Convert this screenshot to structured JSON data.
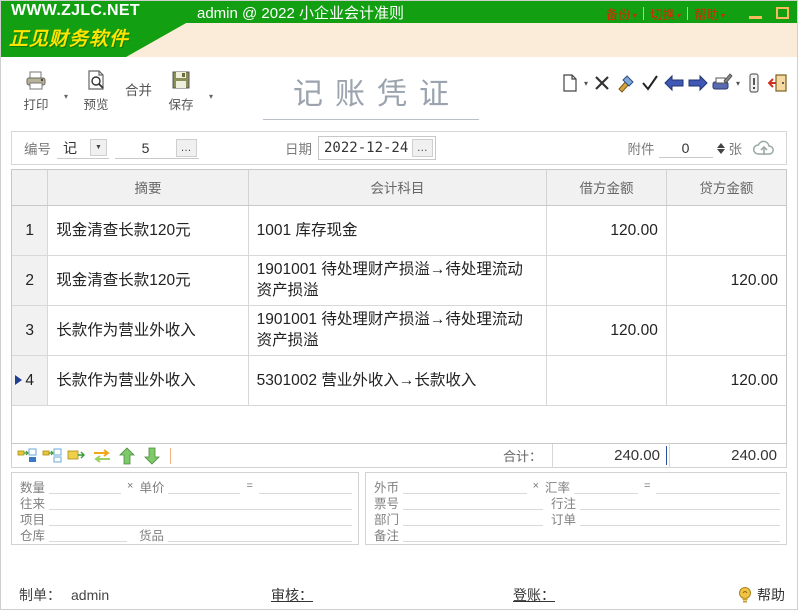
{
  "titlebar": {
    "logo_url": "WWW.ZJLC.NET",
    "logo_cn": "正见财务软件",
    "session": "admin @ 2022 小企业会计准则",
    "menus": [
      {
        "label": "备份",
        "caret": "▾"
      },
      {
        "label": "切换",
        "caret": "▾"
      },
      {
        "label": "帮助",
        "caret": "▾"
      }
    ],
    "window": {
      "minimize": "minimize-button",
      "maximize": "maximize-button"
    }
  },
  "toolbar": {
    "print_label": "打印",
    "preview_label": "预览",
    "merge_label": "合并",
    "save_label": "保存",
    "dropdown_caret": "▾",
    "right_icons": [
      "new-document-icon",
      "delete-x-icon",
      "tools-icon",
      "check-icon",
      "prev-arrow-icon",
      "next-arrow-icon",
      "print-icon",
      "info-icon",
      "exit-icon"
    ]
  },
  "document": {
    "title": "记账凭证"
  },
  "meta": {
    "number_label": "编号",
    "voucher_type": "记",
    "voucher_no": "5",
    "ellipsis": "…",
    "date_label": "日期",
    "date_value": "2022-12-24",
    "attach_label": "附件",
    "attach_count": "0",
    "attach_unit": "张",
    "cloud_icon": "cloud-upload-icon"
  },
  "grid": {
    "columns": [
      "",
      "摘要",
      "会计科目",
      "借方金额",
      "贷方金额"
    ],
    "rows": [
      {
        "index": "1",
        "summary": "现金清查长款120元",
        "account": "1001 库存现金",
        "debit": "120.00",
        "credit": "",
        "selected": false
      },
      {
        "index": "2",
        "summary": "现金清查长款120元",
        "account": "1901001 待处理财产损溢→待处理流动资产损溢",
        "debit": "",
        "credit": "120.00",
        "selected": false
      },
      {
        "index": "3",
        "summary": "长款作为营业外收入",
        "account": "1901001 待处理财产损溢→待处理流动资产损溢",
        "debit": "120.00",
        "credit": "",
        "selected": false
      },
      {
        "index": "4",
        "summary": "长款作为营业外收入",
        "account": "5301002 营业外收入→长款收入",
        "debit": "",
        "credit": "120.00",
        "selected": true
      }
    ]
  },
  "rowbar": {
    "icons": [
      "insert-row-above-icon",
      "insert-row-below-icon",
      "append-row-icon",
      "swap-rows-icon",
      "move-up-icon",
      "move-down-icon"
    ],
    "total_label": "合计：",
    "total_debit": "240.00",
    "total_credit": "240.00"
  },
  "detail_left": {
    "qty_label": "数量",
    "mult_op": "×",
    "price_label": "单价",
    "eq_op": "=",
    "contact_label": "往来",
    "project_label": "项目",
    "warehouse_label": "仓库",
    "goods_label": "货品",
    "qty_value": "",
    "price_value": "",
    "amount_value": "",
    "contact_value": "",
    "project_value": "",
    "warehouse_value": "",
    "goods_value": ""
  },
  "detail_right": {
    "currency_label": "外币",
    "mult_op": "×",
    "rate_label": "汇率",
    "eq_op": "=",
    "bill_no_label": "票号",
    "line_note_label": "行注",
    "dept_label": "部门",
    "order_label": "订单",
    "remark_label": "备注",
    "currency_value": "",
    "rate_value": "",
    "fx_amount_value": "",
    "bill_no_value": "",
    "line_note_value": "",
    "dept_value": "",
    "order_value": "",
    "remark_value": ""
  },
  "footer": {
    "maker_label": "制单：",
    "maker_value": "admin",
    "auditor_label": "审核：",
    "poster_label": "登账：",
    "help_label": "帮助",
    "help_icon": "lightbulb-icon"
  },
  "colors": {
    "brand_green": "#12a012",
    "brand_cream": "#faecd8",
    "brand_yellow": "#ffe400",
    "menu_red": "#d12a00",
    "window_btn": "#f7b95c",
    "title_gray": "#9aa3ae"
  }
}
